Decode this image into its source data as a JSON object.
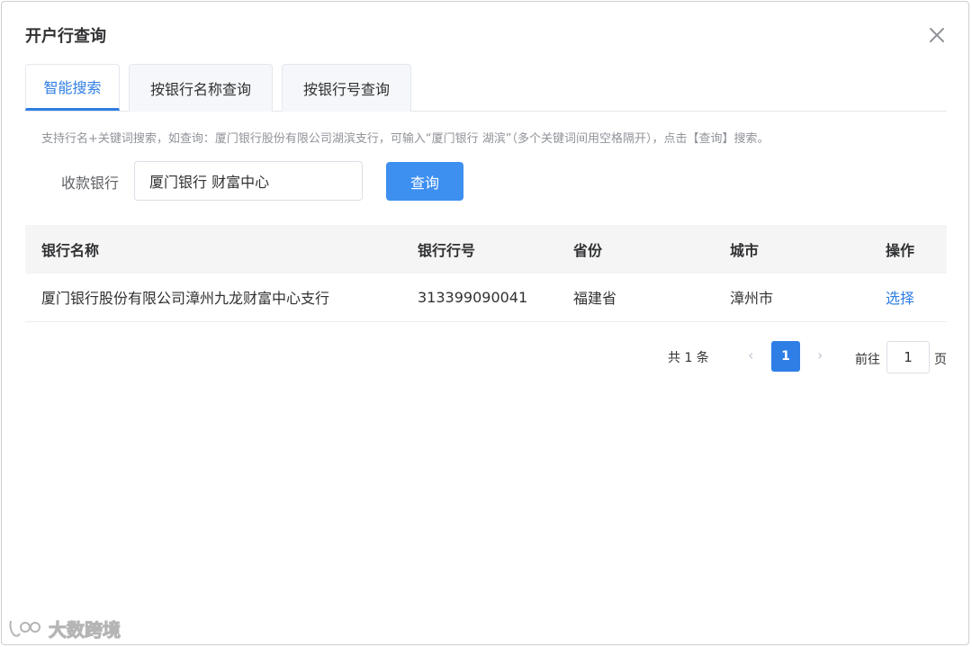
{
  "dialog": {
    "title": "开户行查询"
  },
  "tabs": [
    {
      "label": "智能搜索",
      "active": true
    },
    {
      "label": "按银行名称查询",
      "active": false
    },
    {
      "label": "按银行号查询",
      "active": false
    }
  ],
  "search": {
    "hint": "支持行名+关键词搜索，如查询：厦门银行股份有限公司湖滨支行，可输入“厦门银行 湖滨”（多个关键词间用空格隔开），点击【查询】搜索。",
    "label": "收款银行",
    "value": "厦门银行 财富中心",
    "button_label": "查询"
  },
  "table": {
    "columns": [
      "银行名称",
      "银行行号",
      "省份",
      "城市",
      "操作"
    ],
    "rows": [
      {
        "bank_name": "厦门银行股份有限公司漳州九龙财富中心支行",
        "bank_code": "313399090041",
        "province": "福建省",
        "city": "漳州市",
        "action": "选择"
      }
    ]
  },
  "pagination": {
    "total_text": "共 1 条",
    "prev": "‹",
    "next": "›",
    "current_page": "1",
    "goto_label": "前往",
    "goto_value": "1",
    "goto_unit": "页"
  },
  "watermark": {
    "text": "大数跨境"
  },
  "colors": {
    "accent": "#2f7ee3",
    "button": "#3d8ff0",
    "header_bg": "#f5f5f5"
  }
}
